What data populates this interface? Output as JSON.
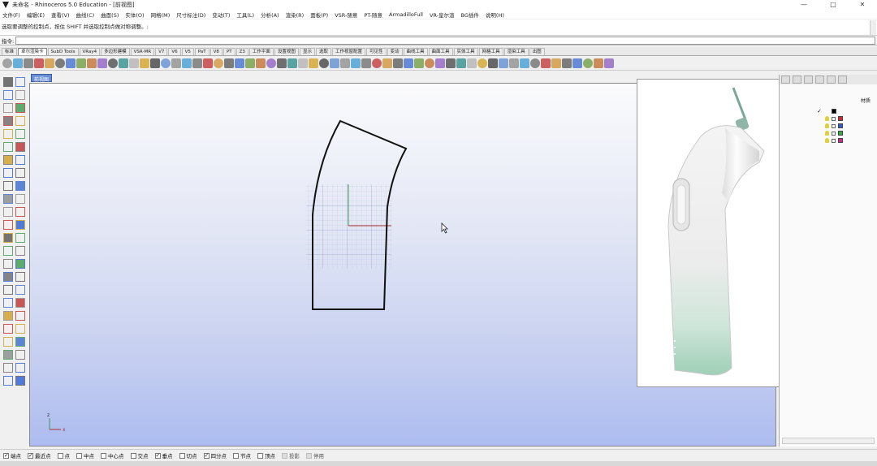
{
  "window": {
    "title": "未命名 - Rhinoceros 5.0 Education - [前视图]",
    "controls": [
      "—",
      "□",
      "✕"
    ]
  },
  "menu": {
    "items": [
      "文件(F)",
      "编辑(E)",
      "查看(V)",
      "曲线(C)",
      "曲面(S)",
      "实体(O)",
      "网格(M)",
      "尺寸标注(D)",
      "变动(T)",
      "工具(L)",
      "分析(A)",
      "渲染(R)",
      "面板(P)",
      "VSR-随意",
      "PT-随意",
      "ArmadilloFull",
      "VR-皇尔渲",
      "BG插件",
      "说明(H)"
    ]
  },
  "command": {
    "history": "选取要调整的控制点，按住 SHIFT 并选取控制点做对称调整。:",
    "prompt_label": "指令:",
    "input_value": ""
  },
  "toolbar_tabs": {
    "items": [
      "标准",
      "卓尔渲染卡",
      "SubD Tools",
      "VRay4",
      "多边形建模",
      "VSR-MR",
      "V7",
      "V6",
      "V5",
      "PaT",
      "V8",
      "PT",
      "Z3",
      "工作平面",
      "设置视图",
      "显示",
      "选取",
      "工作视窗配置",
      "可见性",
      "变动",
      "曲线工具",
      "曲面工具",
      "实体工具",
      "网格工具",
      "渲染工具",
      "出图"
    ],
    "active_index": 1
  },
  "viewport": {
    "label": "前视图",
    "axis_x": "x",
    "axis_z": "z"
  },
  "right_panel": {
    "header": "材质",
    "layers": [
      {
        "color": "#000000",
        "current": true
      },
      {
        "color": "#d02828"
      },
      {
        "color": "#2a5fd0"
      },
      {
        "color": "#28b040"
      },
      {
        "color": "#d02890"
      }
    ]
  },
  "osnap": {
    "items": [
      {
        "label": "端点",
        "checked": true
      },
      {
        "label": "最近点",
        "checked": true
      },
      {
        "label": "点",
        "checked": false
      },
      {
        "label": "中点",
        "checked": false
      },
      {
        "label": "中心点",
        "checked": false
      },
      {
        "label": "交点",
        "checked": false
      },
      {
        "label": "垂点",
        "checked": true
      },
      {
        "label": "切点",
        "checked": false
      },
      {
        "label": "四分点",
        "checked": true
      },
      {
        "label": "节点",
        "checked": false
      },
      {
        "label": "顶点",
        "checked": false
      },
      {
        "label": "投影",
        "checked": false,
        "disabled": true
      },
      {
        "label": "停用",
        "checked": false,
        "disabled": true
      }
    ]
  },
  "colors": {
    "viewport_top": "#fbfbfd",
    "viewport_bottom": "#adbcf0",
    "active_tab": "#6b8fd6"
  }
}
